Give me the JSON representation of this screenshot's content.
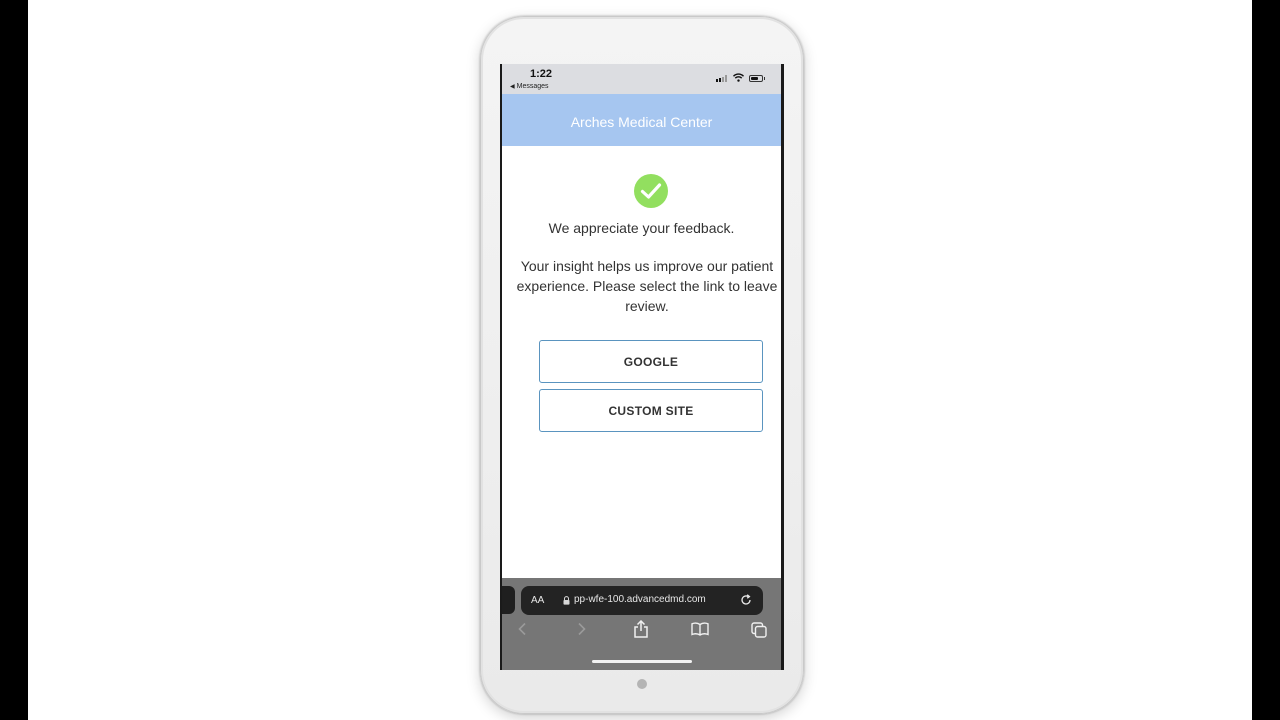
{
  "status": {
    "time": "1:22",
    "back_label": "Messages"
  },
  "header": {
    "title": "Arches Medical Center"
  },
  "confirmation": {
    "heading": "We appreciate your feedback.",
    "body": "Your insight helps us improve our patient experience. Please select the link to leave review."
  },
  "buttons": {
    "google": "GOOGLE",
    "custom_site": "CUSTOM SITE"
  },
  "browser": {
    "text_size_label": "AA",
    "url": "pp-wfe-100.advancedmd.com"
  },
  "colors": {
    "header_bg": "#a6c6f0",
    "check": "#92df5f",
    "button_border": "#5a94bf"
  },
  "icons": [
    "check-icon",
    "lock-icon",
    "reload-icon",
    "back-icon",
    "forward-icon",
    "share-icon",
    "bookmarks-icon",
    "tabs-icon",
    "wifi-icon",
    "battery-icon"
  ]
}
